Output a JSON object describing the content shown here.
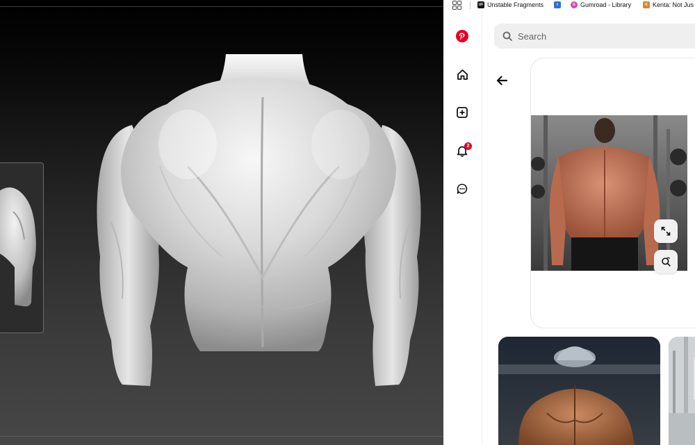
{
  "bookmarks": [
    {
      "label": "Unstable Fragments",
      "icon": "uf-favicon",
      "color": "#111111"
    },
    {
      "label": "",
      "icon": "tumblr-favicon",
      "color": "#2e6fd6"
    },
    {
      "label": "Gumroad - Library",
      "icon": "gumroad-favicon",
      "color": "#d14aa8"
    },
    {
      "label": "Kenta: Not Jus",
      "icon": "kenta-favicon",
      "color": "#d9862b"
    }
  ],
  "rail": {
    "brand_icon": "pinterest-logo-icon",
    "brand_color": "#e60023",
    "items": [
      "home-icon",
      "create-icon",
      "notifications-icon",
      "messages-icon"
    ],
    "notification_count": "2"
  },
  "search": {
    "placeholder": "Search"
  },
  "colors": {
    "accent": "#e60023",
    "search_bg": "#efefef",
    "viewport_bg": "#2a2a2a"
  }
}
